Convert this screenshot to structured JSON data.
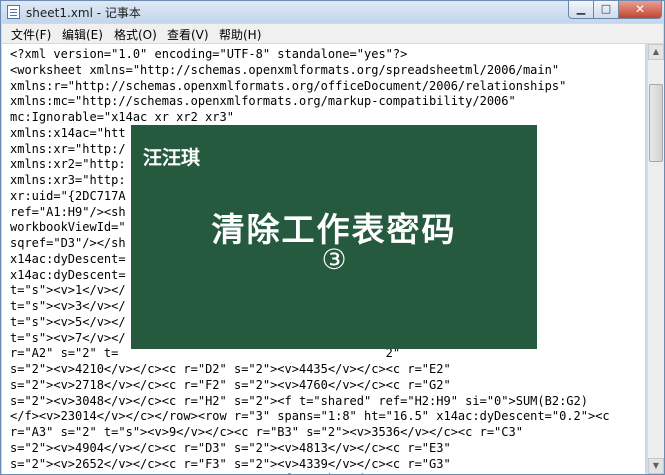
{
  "window": {
    "title": "sheet1.xml - 记事本",
    "controls": {
      "minimize": "▁",
      "maximize": "□",
      "close": "✕"
    }
  },
  "menu": {
    "items": [
      "文件(F)",
      "编辑(E)",
      "格式(O)",
      "查看(V)",
      "帮助(H)"
    ]
  },
  "editor": {
    "lines": [
      "<?xml version=\"1.0\" encoding=\"UTF-8\" standalone=\"yes\"?>",
      "<worksheet xmlns=\"http://schemas.openxmlformats.org/spreadsheetml/2006/main\"",
      "xmlns:r=\"http://schemas.openxmlformats.org/officeDocument/2006/relationships\"",
      "xmlns:mc=\"http://schemas.openxmlformats.org/markup-compatibility/2006\"",
      "mc:Ignorable=\"x14ac xr xr2 xr3\"",
      "xmlns:x14ac=\"htt                                         /ac\"",
      "xmlns:xr=\"http:/                                        sion\"",
      "xmlns:xr2=\"http:                                        sion2\"",
      "xmlns:xr3=\"http:                                        sion3\"",
      "xr:uid=\"{2DC717A",
      "ref=\"A1:H9\"/><sh                                       100\"",
      "workbookViewId=\"",
      "sqref=\"D3\"/></sh                                      \"14.25\"",
      "x14ac:dyDescent=",
      "x14ac:dyDescent=                                         \"",
      "t=\"s\"><v>1</v></",
      "t=\"s\"><v>3</v></",
      "t=\"s\"><v>5</v></",
      "t=\"s\"><v>7</v></                                  cent=\"0.2\"><c",
      "r=\"A2\" s=\"2\" t=                                     2\"",
      "s=\"2\"><v>4210</v></c><c r=\"D2\" s=\"2\"><v>4435</v></c><c r=\"E2\"",
      "s=\"2\"><v>2718</v></c><c r=\"F2\" s=\"2\"><v>4760</v></c><c r=\"G2\"",
      "s=\"2\"><v>3048</v></c><c r=\"H2\" s=\"2\"><f t=\"shared\" ref=\"H2:H9\" si=\"0\">SUM(B2:G2)",
      "</f><v>23014</v></c></row><row r=\"3\" spans=\"1:8\" ht=\"16.5\" x14ac:dyDescent=\"0.2\"><c",
      "r=\"A3\" s=\"2\" t=\"s\"><v>9</v></c><c r=\"B3\" s=\"2\"><v>3536</v></c><c r=\"C3\"",
      "s=\"2\"><v>4904</v></c><c r=\"D3\" s=\"2\"><v>4813</v></c><c r=\"E3\"",
      "s=\"2\"><v>2652</v></c><c r=\"F3\" s=\"2\"><v>4339</v></c><c r=\"G3\"",
      "s=\"2\"><v>2664</v></c><c r=\"H3\" s=\"2\"><f t=\"shared\""
    ]
  },
  "overlay": {
    "name": "汪汪琪",
    "title": "清除工作表密码",
    "number": "③",
    "background": "#265a3f"
  },
  "scrollbar": {
    "up_arrow": "▲",
    "down_arrow": "▼"
  }
}
